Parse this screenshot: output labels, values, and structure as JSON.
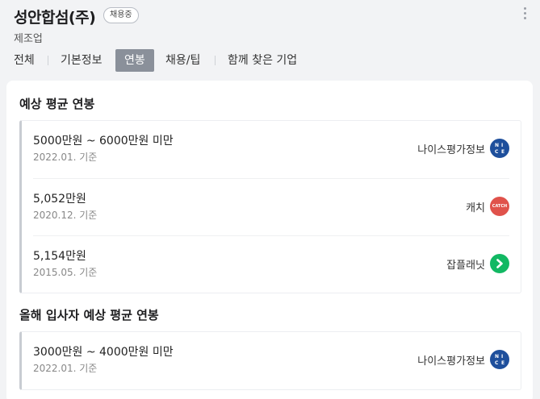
{
  "header": {
    "company_name": "성안합섬(주)",
    "badge": "채용중",
    "industry": "제조업"
  },
  "tabs": [
    {
      "label": "전체"
    },
    {
      "label": "기본정보"
    },
    {
      "label": "연봉"
    },
    {
      "label": "채용/팁"
    },
    {
      "label": "함께 찾은 기업"
    }
  ],
  "active_tab": "연봉",
  "sections": [
    {
      "title": "예상 평균 연봉",
      "rows": [
        {
          "salary": "5000만원 ~ 6000만원 미만",
          "date": "2022.01. 기준",
          "source": "나이스평가정보",
          "logo": "nice-logo-icon"
        },
        {
          "salary": "5,052만원",
          "date": "2020.12. 기준",
          "source": "캐치",
          "logo": "catch-logo-icon"
        },
        {
          "salary": "5,154만원",
          "date": "2015.05. 기준",
          "source": "잡플래닛",
          "logo": "jobplanet-logo-icon"
        }
      ]
    },
    {
      "title": "올해 입사자 예상 평균 연봉",
      "rows": [
        {
          "salary": "3000만원 ~ 4000만원 미만",
          "date": "2022.01. 기준",
          "source": "나이스평가정보",
          "logo": "nice-logo-icon"
        }
      ]
    }
  ],
  "logo_texts": {
    "nice": [
      "N",
      "I",
      "C",
      "E"
    ],
    "catch": "CATCH"
  },
  "colors": {
    "active_tab_bg": "#8a909a",
    "nice_blue": "#1e4f9c",
    "catch_red": "#e0524b",
    "jobplanet_green": "#12b863"
  }
}
